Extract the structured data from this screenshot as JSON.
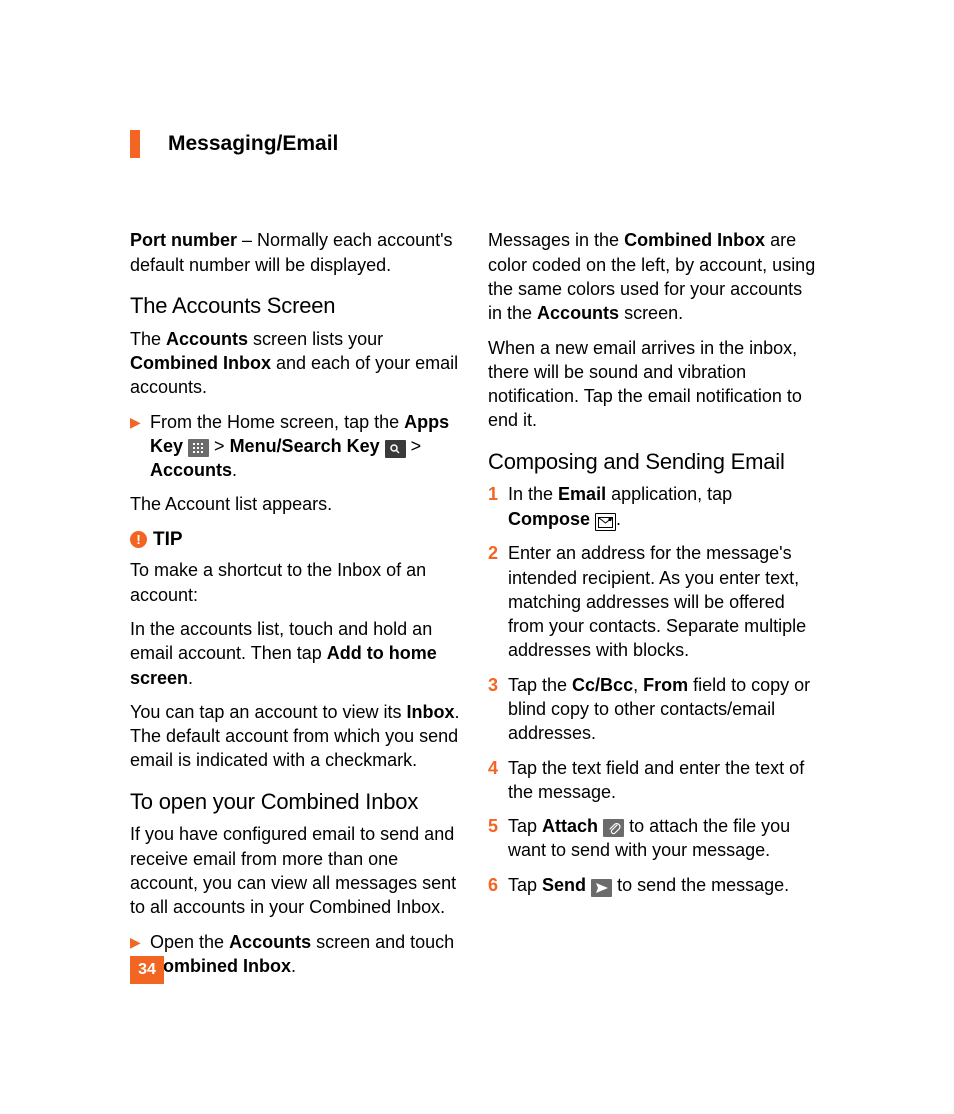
{
  "header": "Messaging/Email",
  "page_number": "34",
  "col1": {
    "p1": {
      "pre": "Port number",
      "post": " – Normally each account's default number will be displayed."
    },
    "h1": "The Accounts Screen",
    "p2": {
      "a": "The ",
      "b": "Accounts",
      "c": " screen lists your ",
      "d": "Combined Inbox",
      "e": " and each of your email accounts."
    },
    "bullet1": {
      "a": "From the Home screen, tap the ",
      "b": "Apps Key",
      "c": " > ",
      "d": "Menu/Search Key",
      "e": " > ",
      "f": "Accounts",
      "g": "."
    },
    "p3": "The Account list appears.",
    "tip_label": "TIP",
    "p4": "To make a shortcut to the Inbox of an account:",
    "p5": {
      "a": "In the accounts list, touch and hold an email account. Then tap ",
      "b": "Add to home screen",
      "c": "."
    },
    "p6": {
      "a": "You can tap an account to view its ",
      "b": "Inbox",
      "c": ". The default account from which you send email is indicated with a checkmark."
    },
    "h2": "To open your Combined Inbox",
    "p7": "If you have configured email to send and receive email from more than one account, you can view all messages sent to all accounts in your Combined Inbox.",
    "bullet2": {
      "a": "Open the ",
      "b": "Accounts",
      "c": " screen and touch ",
      "d": "Combined Inbox",
      "e": "."
    }
  },
  "col2": {
    "p1": {
      "a": "Messages in the ",
      "b": "Combined Inbox",
      "c": " are color coded on the left, by account, using the same colors used for your accounts in the ",
      "d": "Accounts",
      "e": " screen."
    },
    "p2": "When a new email arrives in the inbox, there will be sound and vibration notification. Tap the email notification to end it.",
    "h1": "Composing and Sending Email",
    "steps": {
      "s1": {
        "a": "In the ",
        "b": "Email",
        "c": " application, tap ",
        "d": "Compose",
        "e": "."
      },
      "s2": "Enter an address for the message's intended recipient. As you enter text, matching addresses will be offered from your contacts. Separate multiple addresses with blocks.",
      "s3": {
        "a": "Tap the ",
        "b": "Cc/Bcc",
        "c": ", ",
        "d": "From",
        "e": " field to copy or blind copy to other contacts/email addresses."
      },
      "s4": "Tap the text field and enter the text of the message.",
      "s5": {
        "a": "Tap ",
        "b": "Attach",
        "c": " to attach the file you want to send with your message."
      },
      "s6": {
        "a": "Tap ",
        "b": "Send",
        "c": " to send the message."
      }
    },
    "nums": [
      "1",
      "2",
      "3",
      "4",
      "5",
      "6"
    ]
  }
}
